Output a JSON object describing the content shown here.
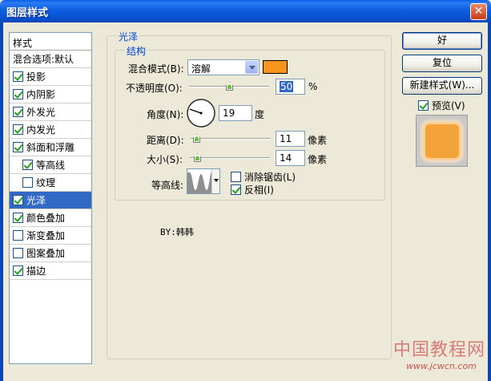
{
  "window": {
    "title": "图层样式"
  },
  "style_list": {
    "header": "样式",
    "items": [
      {
        "label": "混合选项:默认",
        "checkbox": false,
        "checked": false,
        "indent": false,
        "selected": false
      },
      {
        "label": "投影",
        "checkbox": true,
        "checked": true,
        "indent": false,
        "selected": false
      },
      {
        "label": "内阴影",
        "checkbox": true,
        "checked": true,
        "indent": false,
        "selected": false
      },
      {
        "label": "外发光",
        "checkbox": true,
        "checked": true,
        "indent": false,
        "selected": false
      },
      {
        "label": "内发光",
        "checkbox": true,
        "checked": true,
        "indent": false,
        "selected": false
      },
      {
        "label": "斜面和浮雕",
        "checkbox": true,
        "checked": true,
        "indent": false,
        "selected": false
      },
      {
        "label": "等高线",
        "checkbox": true,
        "checked": true,
        "indent": true,
        "selected": false
      },
      {
        "label": "纹理",
        "checkbox": true,
        "checked": false,
        "indent": true,
        "selected": false
      },
      {
        "label": "光泽",
        "checkbox": true,
        "checked": true,
        "indent": false,
        "selected": true
      },
      {
        "label": "颜色叠加",
        "checkbox": true,
        "checked": true,
        "indent": false,
        "selected": false
      },
      {
        "label": "渐变叠加",
        "checkbox": true,
        "checked": false,
        "indent": false,
        "selected": false
      },
      {
        "label": "图案叠加",
        "checkbox": true,
        "checked": false,
        "indent": false,
        "selected": false
      },
      {
        "label": "描边",
        "checkbox": true,
        "checked": true,
        "indent": false,
        "selected": false
      }
    ]
  },
  "gloss": {
    "group_title": "光泽",
    "structure_title": "结构",
    "blend_mode": {
      "label": "混合模式(B):",
      "value": "溶解",
      "color": "#f7941d"
    },
    "opacity": {
      "label": "不透明度(O):",
      "value": "50",
      "unit": "%",
      "percent": 50
    },
    "angle": {
      "label": "角度(N):",
      "value": "19",
      "unit": "度",
      "degrees": 19
    },
    "distance": {
      "label": "距离(D):",
      "value": "11",
      "unit": "像素",
      "max": 250
    },
    "size": {
      "label": "大小(S):",
      "value": "14",
      "unit": "像素",
      "max": 250
    },
    "contour": {
      "label": "等高线:",
      "anti_alias_label": "消除锯齿(L)",
      "anti_alias": false,
      "invert_label": "反相(I)",
      "invert": true
    }
  },
  "credit": "BY:韩韩",
  "buttons": {
    "ok": "好",
    "reset": "复位",
    "new_style": "新建样式(W)...",
    "preview_label": "预览(V)",
    "preview_checked": true
  },
  "watermark": {
    "text": "中国教程网",
    "url": "www.jcwcn.com"
  },
  "colors": {
    "selection": "#316ac5",
    "accent_legend": "#0046d5",
    "preview_fill": "#f4a33a"
  }
}
